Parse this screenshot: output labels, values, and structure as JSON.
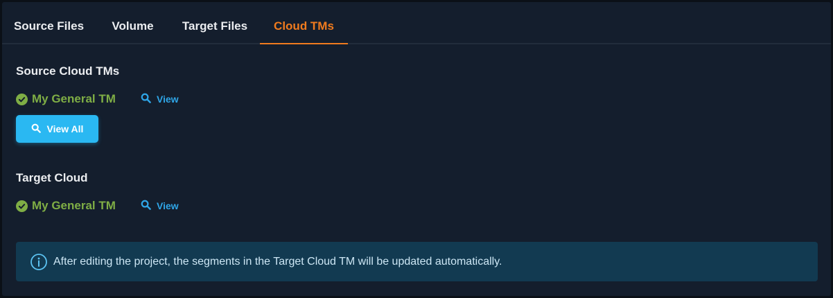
{
  "tabs": [
    {
      "label": "Source Files",
      "active": false
    },
    {
      "label": "Volume",
      "active": false
    },
    {
      "label": "Target Files",
      "active": false
    },
    {
      "label": "Cloud TMs",
      "active": true
    }
  ],
  "source_section": {
    "heading": "Source Cloud TMs",
    "tm": {
      "name": "My General TM",
      "status_icon": "check-circle-icon",
      "view_label": "View"
    },
    "view_all_label": "View All"
  },
  "target_section": {
    "heading": "Target Cloud",
    "tm": {
      "name": "My General TM",
      "status_icon": "check-circle-icon",
      "view_label": "View"
    }
  },
  "info": {
    "icon": "info-icon",
    "text": "After editing the project, the segments in the Target Cloud TM will be updated automatically."
  },
  "colors": {
    "background": "#141e2d",
    "active_tab": "#f07b1e",
    "tm_green": "#7fae45",
    "link_blue": "#2fa6e8",
    "button_blue": "#2ab8f2",
    "info_bg": "#123a51"
  }
}
